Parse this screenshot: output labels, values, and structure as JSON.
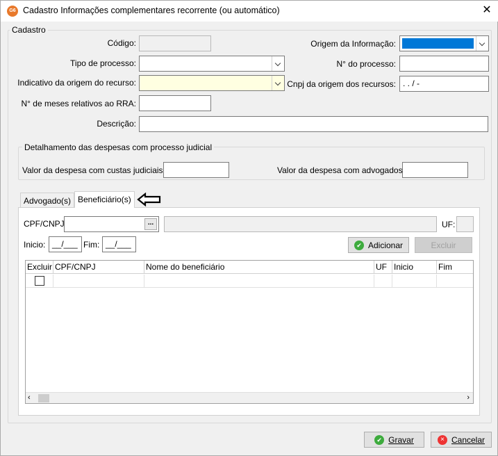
{
  "window": {
    "title": "Cadastro Informações complementares recorrente (ou automático)",
    "app_icon_text": "G6"
  },
  "cadastro": {
    "legend": "Cadastro",
    "codigo_label": "Código:",
    "origem_label": "Origem da Informação:",
    "tipo_processo_label": "Tipo de processo:",
    "num_processo_label": "N° do processo:",
    "indicativo_label": "Indicativo da origem do recurso:",
    "cnpj_origem_label": "Cnpj da origem dos recursos:",
    "cnpj_origem_value": " .  .  /  -",
    "meses_rra_label": "N° de meses relativos ao RRA:",
    "descricao_label": "Descrição:"
  },
  "despesas": {
    "legend": "Detalhamento das despesas com processo judicial",
    "custas_label": "Valor da despesa com custas judiciais:",
    "advogados_label": "Valor da despesa com advogados"
  },
  "tabs": [
    {
      "label": "Advogado(s)"
    },
    {
      "label": "Beneficiário(s)"
    }
  ],
  "arrow_icon": "arrow-left-icon",
  "beneficiarios": {
    "cpf_label": "CPF/CNPJ:",
    "lookup_btn": "...",
    "uf_label": "UF:",
    "inicio_label": "Inicio:",
    "inicio_value": "__/___",
    "fim_label": "Fim:",
    "fim_value": "__/___",
    "adicionar_label": "Adicionar",
    "excluir_label": "Excluir",
    "grid_headers": [
      "Excluir",
      "CPF/CNPJ",
      "Nome do beneficiário",
      "UF",
      "Inicio",
      "Fim"
    ]
  },
  "footer": {
    "gravar_label": "Gravar",
    "cancelar_label": "Cancelar"
  },
  "colors": {
    "selection": "#0078d7",
    "required_field": "#ffffe1",
    "ok": "#3dab3d",
    "cancel": "#ee3333"
  }
}
